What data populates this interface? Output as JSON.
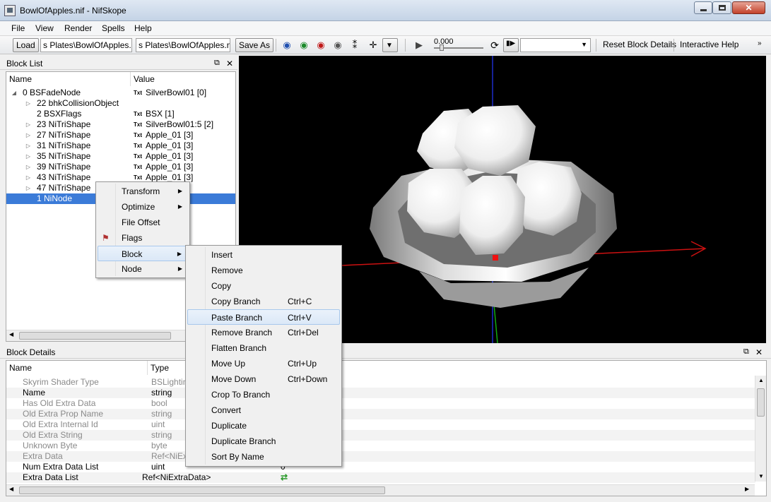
{
  "window": {
    "title": "BowlOfApples.nif - NifSkope"
  },
  "menubar": {
    "items": [
      "File",
      "View",
      "Render",
      "Spells",
      "Help"
    ]
  },
  "toolbar": {
    "load_label": "Load",
    "load_path": "s Plates\\BowlOfApples.nif",
    "save_path": "s Plates\\BowlOfApples.nif",
    "save_as_label": "Save As",
    "time_value": "0.000",
    "reset_label": "Reset Block Details",
    "help_label": "Interactive Help"
  },
  "block_list": {
    "title": "Block List",
    "col_name": "Name",
    "col_value": "Value",
    "rows": [
      {
        "name": "0 BSFadeNode",
        "value": "SilverBowl01 [0]",
        "tag": "Txt"
      },
      {
        "name": "22 bhkCollisionObject",
        "value": "",
        "tag": ""
      },
      {
        "name": "2 BSXFlags",
        "value": "BSX [1]",
        "tag": "Txt"
      },
      {
        "name": "23 NiTriShape",
        "value": "SilverBowl01:5 [2]",
        "tag": "Txt"
      },
      {
        "name": "27 NiTriShape",
        "value": "Apple_01 [3]",
        "tag": "Txt"
      },
      {
        "name": "31 NiTriShape",
        "value": "Apple_01 [3]",
        "tag": "Txt"
      },
      {
        "name": "35 NiTriShape",
        "value": "Apple_01 [3]",
        "tag": "Txt"
      },
      {
        "name": "39 NiTriShape",
        "value": "Apple_01 [3]",
        "tag": "Txt"
      },
      {
        "name": "43 NiTriShape",
        "value": "Apple_01 [3]",
        "tag": "Txt"
      },
      {
        "name": "47 NiTriShape",
        "value": "",
        "tag": ""
      },
      {
        "name": "1 NiNode",
        "value": "",
        "tag": ""
      }
    ]
  },
  "context_menu": {
    "items": [
      "Transform",
      "Optimize",
      "File Offset",
      "Flags",
      "Block",
      "Node"
    ]
  },
  "block_submenu": {
    "items": [
      {
        "label": "Insert",
        "shortcut": ""
      },
      {
        "label": "Remove",
        "shortcut": ""
      },
      {
        "label": "Copy",
        "shortcut": ""
      },
      {
        "label": "Copy Branch",
        "shortcut": "Ctrl+C"
      },
      {
        "label": "Paste Branch",
        "shortcut": "Ctrl+V"
      },
      {
        "label": "Remove Branch",
        "shortcut": "Ctrl+Del"
      },
      {
        "label": "Flatten Branch",
        "shortcut": ""
      },
      {
        "label": "Move Up",
        "shortcut": "Ctrl+Up"
      },
      {
        "label": "Move Down",
        "shortcut": "Ctrl+Down"
      },
      {
        "label": "Crop To Branch",
        "shortcut": ""
      },
      {
        "label": "Convert",
        "shortcut": ""
      },
      {
        "label": "Duplicate",
        "shortcut": ""
      },
      {
        "label": "Duplicate Branch",
        "shortcut": ""
      },
      {
        "label": "Sort By Name",
        "shortcut": ""
      }
    ]
  },
  "block_details": {
    "title": "Block Details",
    "col_name": "Name",
    "col_type": "Type",
    "rows": [
      {
        "name": "Skyrim Shader Type",
        "type": "BSLightin",
        "value": ""
      },
      {
        "name": "Name",
        "type": "string",
        "value": ""
      },
      {
        "name": "Has Old Extra Data",
        "type": "bool",
        "value": ""
      },
      {
        "name": "Old Extra Prop Name",
        "type": "string",
        "value": ""
      },
      {
        "name": "Old Extra Internal Id",
        "type": "uint",
        "value": ""
      },
      {
        "name": "Old Extra String",
        "type": "string",
        "value": ""
      },
      {
        "name": "Unknown Byte",
        "type": "byte",
        "value": ""
      },
      {
        "name": "Extra Data",
        "type": "Ref<NiEx",
        "value": ""
      },
      {
        "name": "Num Extra Data List",
        "type": "uint",
        "value": "0"
      },
      {
        "name": "Extra Data List",
        "type": "Ref<NiExtraData>",
        "value": ""
      }
    ]
  }
}
